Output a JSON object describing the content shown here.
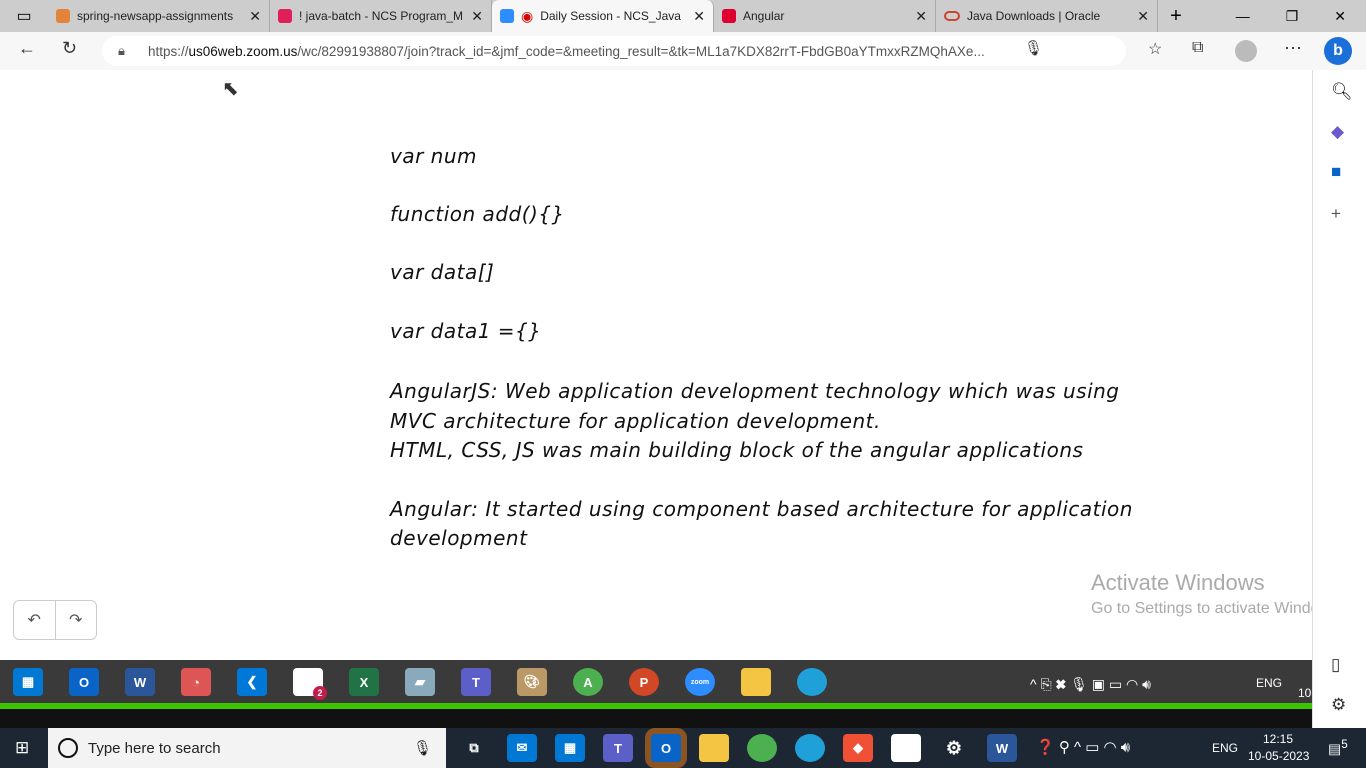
{
  "browser": {
    "tabs": [
      {
        "title": "spring-newsapp-assignments",
        "color": "#e2843c"
      },
      {
        "title": "! java-batch - NCS Program_M",
        "color": "#e01e5a"
      },
      {
        "title": "Daily Session - NCS_Java",
        "color": "#2d8cff",
        "active": true
      },
      {
        "title": "Angular",
        "color": "#dd0031"
      },
      {
        "title": "Java Downloads | Oracle",
        "color": "#c74634"
      }
    ],
    "url_prefix": "https://",
    "url_host": "us06web.zoom.us",
    "url_path": "/wc/82991938807/join?track_id=&jmf_code=&meeting_result=&tk=ML1a7KDX82rrT-FbdGB0aYTmxxRZMQhAXe..."
  },
  "whiteboard": {
    "lines": [
      "var num",
      "function add(){}",
      "var data[]",
      "var data1 ={}",
      "AngularJS:  Web application development technology which was using",
      "MVC architecture for application development.",
      "HTML, CSS, JS was main building block of the angular applications",
      "Angular: It started using component based architecture for application",
      "development"
    ]
  },
  "watermark": {
    "title": "Activate Windows",
    "subtitle": "Go to Settings to activate Windows."
  },
  "remote_taskbar": {
    "apps": [
      "store",
      "outlook",
      "word",
      "paint3d",
      "vscode",
      "slack",
      "excel",
      "notepad",
      "teams",
      "paint",
      "chrome",
      "powerpoint",
      "zoom",
      "explorer",
      "edge"
    ],
    "slack_badge": "2",
    "lang": "ENG",
    "clock_partial": "10"
  },
  "taskbar": {
    "search_placeholder": "Type here to search",
    "lang": "ENG",
    "time": "12:15",
    "date": "10-05-2023",
    "notifications": "5"
  }
}
